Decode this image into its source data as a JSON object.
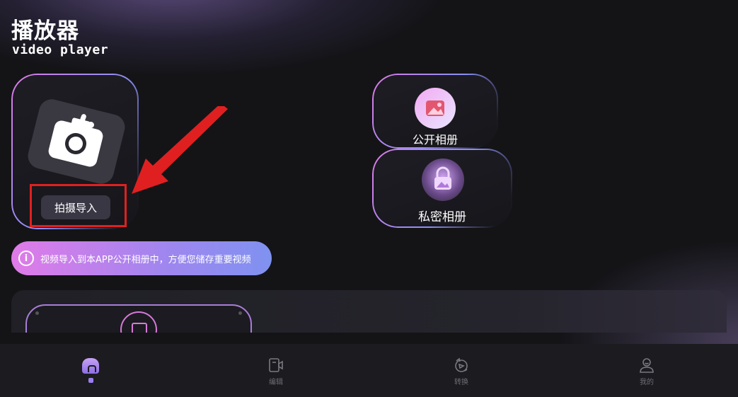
{
  "header": {
    "title": "播放器",
    "subtitle": "video player"
  },
  "shoot_card": {
    "button_label": "拍摄导入",
    "icon": "camera-icon"
  },
  "albums": {
    "public": {
      "label": "公开相册",
      "icon": "image-icon"
    },
    "private": {
      "label": "私密相册",
      "icon": "lock-image-icon"
    }
  },
  "info_banner": {
    "icon": "info-icon",
    "text": "视频导入到本APP公开相册中，方便您储存重要视频"
  },
  "content_panel": {
    "icon": "video-play-icon"
  },
  "tabbar": {
    "items": [
      {
        "label": "",
        "icon": "home-icon",
        "active": true
      },
      {
        "label": "编辑",
        "icon": "edit-video-icon",
        "active": false
      },
      {
        "label": "转换",
        "icon": "convert-icon",
        "active": false
      },
      {
        "label": "我的",
        "icon": "profile-icon",
        "active": false
      }
    ]
  },
  "colors": {
    "accent_pink": "#e07be8",
    "accent_blue": "#7f92f0",
    "highlight_red": "#e02020",
    "background": "#141417"
  }
}
